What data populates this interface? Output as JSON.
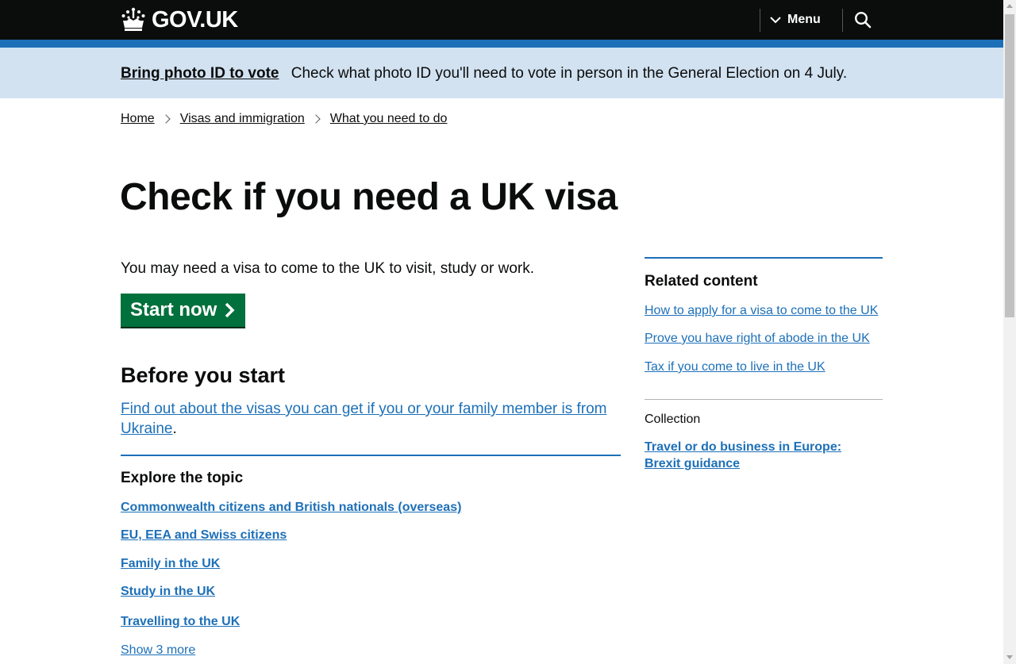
{
  "header": {
    "logo_text": "GOV.UK",
    "logo_icon": "crown-icon",
    "menu_label": "Menu",
    "menu_icon": "chevron-down-icon",
    "search_icon": "search-icon",
    "background": "#0b0c0c",
    "accent": "#1d70b8"
  },
  "banner": {
    "link_text": "Bring photo ID to vote",
    "text": "Check what photo ID you'll need to vote in person in the General Election on 4 July.",
    "background": "#d2e2f1"
  },
  "breadcrumb": {
    "items": [
      {
        "label": "Home"
      },
      {
        "label": "Visas and immigration"
      },
      {
        "label": "What you need to do"
      }
    ]
  },
  "main": {
    "title": "Check if you need a UK visa",
    "intro": "You may need a visa to come to the UK to visit, study or work.",
    "start_button": {
      "label": "Start now",
      "icon": "chevron-right-icon",
      "color": "#00703c"
    },
    "before_heading": "Before you start",
    "before_link": "Find out about the visas you can get if you or your family member is from Ukraine",
    "before_suffix": ".",
    "explore_heading": "Explore the topic",
    "topics": [
      {
        "label": "Commonwealth citizens and British nationals (overseas)"
      },
      {
        "label": "EU, EEA and Swiss citizens"
      },
      {
        "label": "Family in the UK"
      },
      {
        "label": "Study in the UK"
      },
      {
        "label": "Travelling to the UK"
      }
    ],
    "show_more": "Show 3 more"
  },
  "sidebar": {
    "related_heading": "Related content",
    "related_links": [
      {
        "label": "How to apply for a visa to come to the UK"
      },
      {
        "label": "Prove you have right of abode in the UK"
      },
      {
        "label": "Tax if you come to live in the UK"
      }
    ],
    "collection_label": "Collection",
    "collection_link": "Travel or do business in Europe: Brexit guidance"
  }
}
